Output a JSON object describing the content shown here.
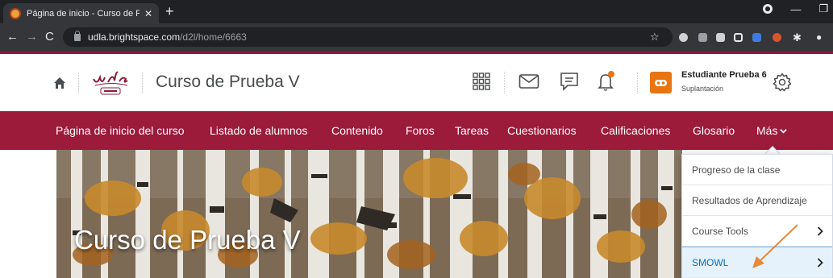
{
  "browser": {
    "tab_title": "Página de inicio - Curso de Pruel",
    "tab_close": "✕",
    "new_tab": "+",
    "url_host": "udla.brightspace.com",
    "url_path": "/d2l/home/6663"
  },
  "header": {
    "course_title": "Curso de Prueba V",
    "user_name": "Estudiante Prueba 6",
    "user_role": "Suplantación"
  },
  "nav": {
    "items": [
      "Página de inicio del curso",
      "Listado de alumnos",
      "Contenido",
      "Foros",
      "Tareas",
      "Cuestionarios",
      "Calificaciones",
      "Glosario",
      "Más"
    ]
  },
  "banner": {
    "title": "Curso de Prueba V"
  },
  "dropdown": {
    "items": [
      "Progreso de la clase",
      "Resultados de Aprendizaje",
      "Course Tools",
      "SMOWL"
    ]
  },
  "colors": {
    "brand": "#9c1a3a",
    "accent": "#e87511",
    "highlight": "#e6f2fb",
    "link": "#006fbf"
  }
}
